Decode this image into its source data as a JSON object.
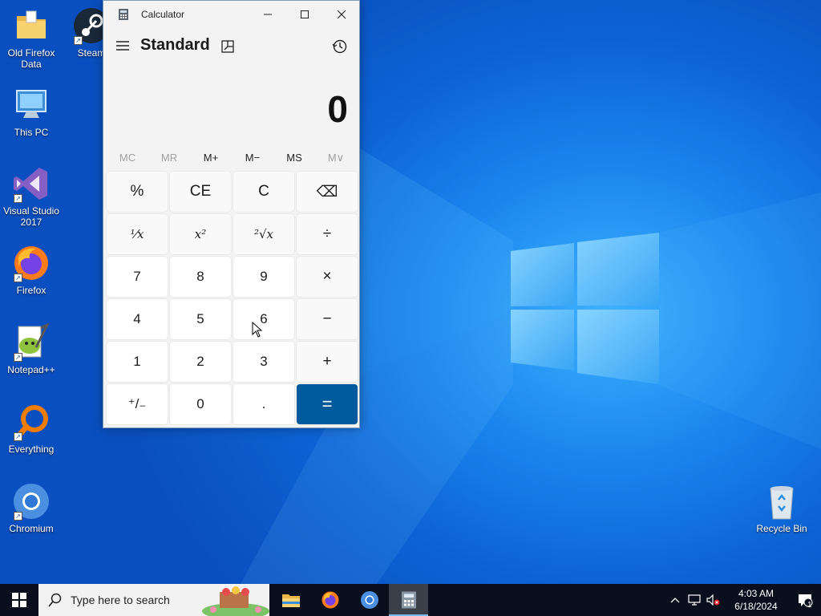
{
  "desktop": {
    "icons": [
      {
        "label": "Old Firefox Data",
        "icon": "folder-icon"
      },
      {
        "label": "Steam",
        "icon": "steam-icon"
      },
      {
        "label": "This PC",
        "icon": "computer-icon"
      },
      {
        "label": "Visual Studio 2017",
        "icon": "visual-studio-icon"
      },
      {
        "label": "Firefox",
        "icon": "firefox-icon"
      },
      {
        "label": "Notepad++",
        "icon": "notepadpp-icon"
      },
      {
        "label": "Everything",
        "icon": "everything-search-icon"
      },
      {
        "label": "Chromium",
        "icon": "chromium-icon"
      },
      {
        "label": "Recycle Bin",
        "icon": "recycle-bin-icon"
      }
    ]
  },
  "calculator": {
    "window_title": "Calculator",
    "mode": "Standard",
    "display_value": "0",
    "memory_buttons": [
      {
        "label": "MC",
        "enabled": false
      },
      {
        "label": "MR",
        "enabled": false
      },
      {
        "label": "M+",
        "enabled": true
      },
      {
        "label": "M−",
        "enabled": true
      },
      {
        "label": "MS",
        "enabled": true
      },
      {
        "label": "M∨",
        "enabled": false
      }
    ],
    "keys": [
      {
        "label": "%",
        "name": "percent-key",
        "kind": "op"
      },
      {
        "label": "CE",
        "name": "clear-entry-key",
        "kind": "op"
      },
      {
        "label": "C",
        "name": "clear-key",
        "kind": "op"
      },
      {
        "label": "⌫",
        "name": "backspace-key",
        "kind": "op"
      },
      {
        "label": "⅟x",
        "name": "reciprocal-key",
        "kind": "fn"
      },
      {
        "label": "x²",
        "name": "square-key",
        "kind": "fn"
      },
      {
        "label": "²√x",
        "name": "square-root-key",
        "kind": "fn"
      },
      {
        "label": "÷",
        "name": "divide-key",
        "kind": "op"
      },
      {
        "label": "7",
        "name": "digit-7-key",
        "kind": "num"
      },
      {
        "label": "8",
        "name": "digit-8-key",
        "kind": "num"
      },
      {
        "label": "9",
        "name": "digit-9-key",
        "kind": "num"
      },
      {
        "label": "×",
        "name": "multiply-key",
        "kind": "op"
      },
      {
        "label": "4",
        "name": "digit-4-key",
        "kind": "num"
      },
      {
        "label": "5",
        "name": "digit-5-key",
        "kind": "num"
      },
      {
        "label": "6",
        "name": "digit-6-key",
        "kind": "num"
      },
      {
        "label": "−",
        "name": "subtract-key",
        "kind": "op"
      },
      {
        "label": "1",
        "name": "digit-1-key",
        "kind": "num"
      },
      {
        "label": "2",
        "name": "digit-2-key",
        "kind": "num"
      },
      {
        "label": "3",
        "name": "digit-3-key",
        "kind": "num"
      },
      {
        "label": "+",
        "name": "add-key",
        "kind": "op"
      },
      {
        "label": "⁺/₋",
        "name": "negate-key",
        "kind": "num"
      },
      {
        "label": "0",
        "name": "digit-0-key",
        "kind": "num"
      },
      {
        "label": ".",
        "name": "decimal-key",
        "kind": "num"
      },
      {
        "label": "=",
        "name": "equals-key",
        "kind": "eq"
      }
    ]
  },
  "taskbar": {
    "search_placeholder": "Type here to search",
    "pinned_apps": [
      "file-explorer-icon",
      "firefox-icon",
      "chromium-icon",
      "calculator-icon"
    ],
    "clock_time": "4:03 AM",
    "clock_date": "6/18/2024",
    "notification_count": "1"
  },
  "colors": {
    "accent_equals": "#005a9e",
    "taskbar_bg": "#0a0f1d"
  }
}
